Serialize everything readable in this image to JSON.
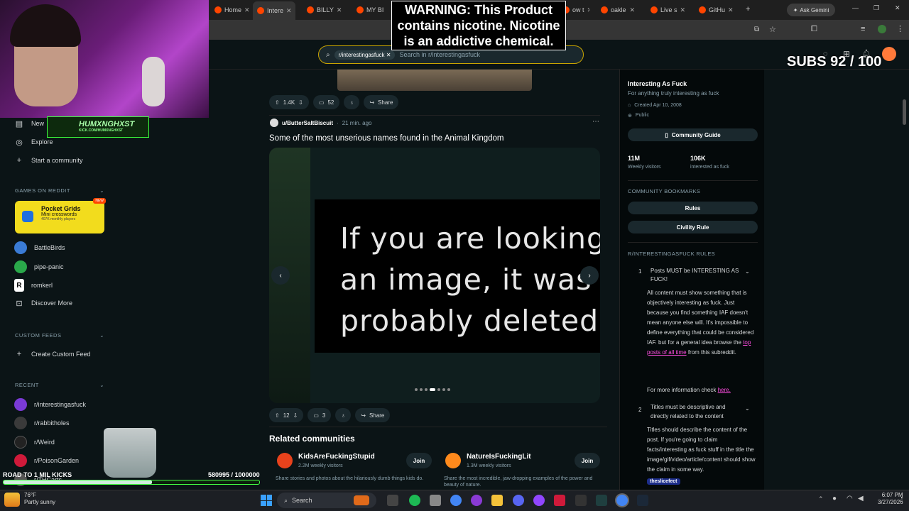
{
  "browser": {
    "tabs": [
      {
        "label": "Home",
        "active": false
      },
      {
        "label": "Intere",
        "active": true
      },
      {
        "label": "BILLY",
        "active": false
      },
      {
        "label": "MY BI",
        "active": false
      },
      {
        "label": "ow t",
        "active": false
      },
      {
        "label": "oakle",
        "active": false
      },
      {
        "label": "Live s",
        "active": false
      },
      {
        "label": "GitHu",
        "active": false
      }
    ],
    "ask_gemini": "Ask Gemini"
  },
  "stream": {
    "warning": "WARNING: This Product contains nicotine. Nicotine is an addictive chemical.",
    "subs": "SUBS 92 / 100",
    "logo_name": "HUMXNGHXST",
    "logo_sub": "KICK.COM/HUMXNGHXST",
    "kicks_label": "ROAD TO 1 MIL KICKS",
    "kicks_count": "580995 / 1000000",
    "kicks_progress": 0.581
  },
  "search": {
    "chip": "r/interestingasfuck",
    "placeholder": "Search in r/interestingasfuck"
  },
  "sidebar": {
    "top_items": [
      {
        "label": "New",
        "icon": "news-icon"
      },
      {
        "label": "Explore",
        "icon": "explore-icon"
      },
      {
        "label": "Start a community",
        "icon": "plus-icon"
      }
    ],
    "games_header": "GAMES ON REDDIT",
    "pocket": {
      "title": "Pocket Grids",
      "subtitle": "Mini crosswords",
      "meta": "407K monthly players",
      "badge": "NEW"
    },
    "games": [
      {
        "label": "BattleBirds",
        "color": "#3a7bd5"
      },
      {
        "label": "pipe-panic",
        "color": "#2aa84a"
      },
      {
        "label": "romkerl",
        "color": "#ffffff"
      },
      {
        "label": "Discover More",
        "color": ""
      }
    ],
    "custom_header": "CUSTOM FEEDS",
    "create_feed": "Create Custom Feed",
    "recent_header": "RECENT",
    "recent": [
      {
        "label": "r/interestingasfuck",
        "color": "#7a3ad5"
      },
      {
        "label": "r/rabbitholes",
        "color": "#3a3a3a"
      },
      {
        "label": "r/Weird",
        "color": "#222222"
      },
      {
        "label": "r/PoisonGarden",
        "color": "#d01a3a"
      },
      {
        "label": "r/THCarts",
        "color": "#555555"
      }
    ]
  },
  "prev_post": {
    "upvotes": "1.4K",
    "comments": "52",
    "share": "Share"
  },
  "post": {
    "author": "u/ButterSaltBiscuit",
    "time": "21 min. ago",
    "title": "Some of the most unserious names found in the Animal Kingdom",
    "image_text": [
      "If you are looking fo",
      "an image, it was",
      "probably deleted."
    ],
    "upvotes": "12",
    "comments": "3",
    "share": "Share",
    "gallery_index": 4,
    "gallery_total": 7
  },
  "related": {
    "header": "Related communities",
    "items": [
      {
        "name": "KidsAreFuckingStupid",
        "visitors": "2.2M weekly visitors",
        "desc": "Share stories and photos about the hilariously dumb things kids do.",
        "join": "Join",
        "color": "#e8421c"
      },
      {
        "name": "NatureIsFuckingLit",
        "visitors": "1.3M weekly visitors",
        "desc": "Share the most incredible, jaw-dropping examples of the power and beauty of nature.",
        "join": "Join",
        "color": "#ff8a1c"
      }
    ]
  },
  "community": {
    "name": "Interesting As Fuck",
    "tagline": "For anything truly interesting as fuck",
    "created": "Created Apr 10, 2008",
    "visibility": "Public",
    "guide_button": "Community Guide",
    "stats": [
      {
        "value": "11M",
        "label": "Weekly visitors"
      },
      {
        "value": "106K",
        "label": "interested as fuck"
      }
    ],
    "bookmarks_header": "COMMUNITY BOOKMARKS",
    "bookmarks": [
      "Rules",
      "Civility Rule"
    ],
    "rules_header": "R/INTERESTINGASFUCK RULES",
    "rules": [
      {
        "num": "1",
        "title": "Posts MUST be INTERESTING AS FUCK!",
        "body": "All content must show something that is objectively interesting as fuck. Just because you find something IAF doesn't mean anyone else will. It's impossible to define everything that could be considered IAF. but for a general idea browse the",
        "link": "top posts of all time",
        "body_after": "from this subreddit.",
        "more_prefix": "For more information check",
        "more_link": "here."
      },
      {
        "num": "2",
        "title": "Titles must be descriptive and directly related to the content",
        "body": "Titles should describe the content of the post. If you're going to claim facts/interesting as fuck stuff in the title the image/gif/video/article/content should show the claim in some way."
      }
    ],
    "overlay_user": "theslicefect"
  },
  "taskbar": {
    "weather_temp": "76°F",
    "weather_desc": "Partly sunny",
    "search_placeholder": "Search",
    "time": "6:07 PM",
    "date": "3/27/2026"
  }
}
